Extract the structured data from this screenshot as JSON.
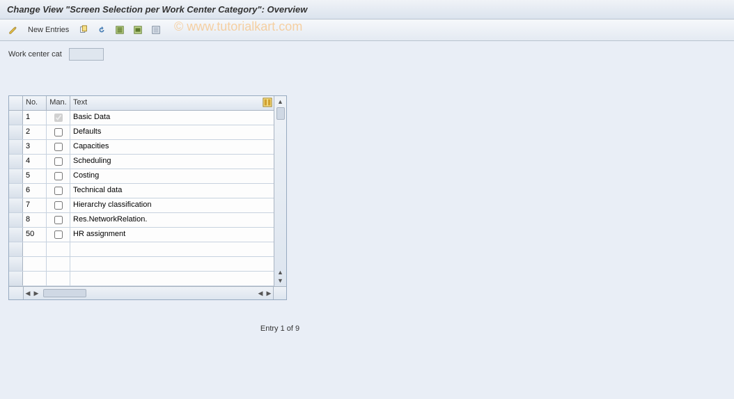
{
  "title": "Change View \"Screen Selection per Work Center Category\": Overview",
  "watermark": "© www.tutorialkart.com",
  "toolbar": {
    "new_entries_label": "New Entries"
  },
  "field": {
    "label": "Work center cat",
    "value": ""
  },
  "grid": {
    "headers": {
      "no": "No.",
      "man": "Man.",
      "text": "Text"
    },
    "rows": [
      {
        "no": "1",
        "man": true,
        "man_disabled": true,
        "text": "Basic Data"
      },
      {
        "no": "2",
        "man": false,
        "man_disabled": false,
        "text": "Defaults"
      },
      {
        "no": "3",
        "man": false,
        "man_disabled": false,
        "text": "Capacities"
      },
      {
        "no": "4",
        "man": false,
        "man_disabled": false,
        "text": "Scheduling"
      },
      {
        "no": "5",
        "man": false,
        "man_disabled": false,
        "text": "Costing"
      },
      {
        "no": "6",
        "man": false,
        "man_disabled": false,
        "text": "Technical data"
      },
      {
        "no": "7",
        "man": false,
        "man_disabled": false,
        "text": "Hierarchy classification"
      },
      {
        "no": "8",
        "man": false,
        "man_disabled": false,
        "text": "Res.NetworkRelation."
      },
      {
        "no": "50",
        "man": false,
        "man_disabled": false,
        "text": "HR assignment"
      }
    ],
    "empty_rows": 3
  },
  "status": "Entry 1 of 9",
  "icons": {
    "change": "change-icon",
    "copy": "copy-icon",
    "undo": "undo-icon",
    "select_all": "select-all-icon",
    "select_block": "select-block-icon",
    "deselect_all": "deselect-all-icon",
    "config": "table-settings-icon"
  }
}
